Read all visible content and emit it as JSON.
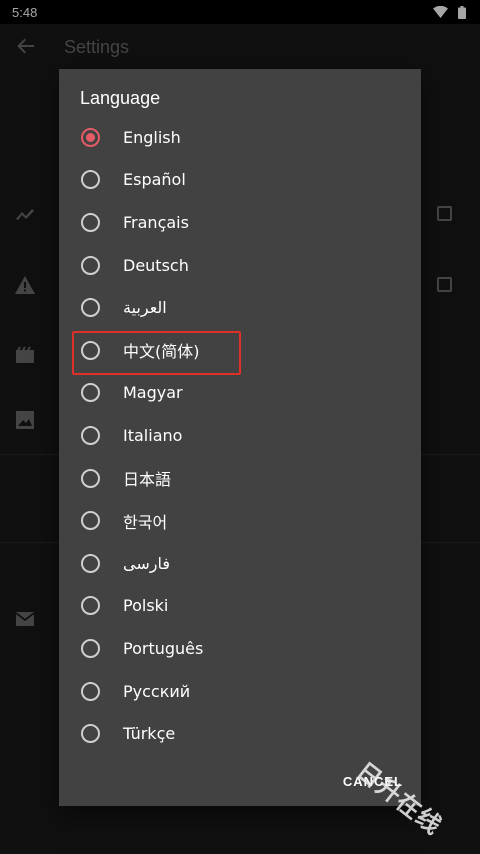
{
  "status_bar": {
    "time": "5:48",
    "icons": [
      "wifi-icon",
      "battery-icon"
    ]
  },
  "settings_page": {
    "title": "Settings",
    "icons": [
      "trending-icon",
      "warning-icon",
      "movie-icon",
      "image-icon",
      "mail-icon"
    ]
  },
  "dialog": {
    "title": "Language",
    "selected": "English",
    "options": [
      "English",
      "Español",
      "Français",
      "Deutsch",
      "العربية",
      "中文(简体)",
      "Magyar",
      "Italiano",
      "日本語",
      "한국어",
      "فارسی",
      "Polski",
      "Português",
      "Русский",
      "Türkçe"
    ],
    "cancel_label": "CANCEL"
  },
  "highlighted_option": "中文(简体)",
  "watermark": "日升在线",
  "colors": {
    "accent": "#e45b66",
    "highlight": "#e0302a",
    "dialog_bg": "#424242"
  }
}
